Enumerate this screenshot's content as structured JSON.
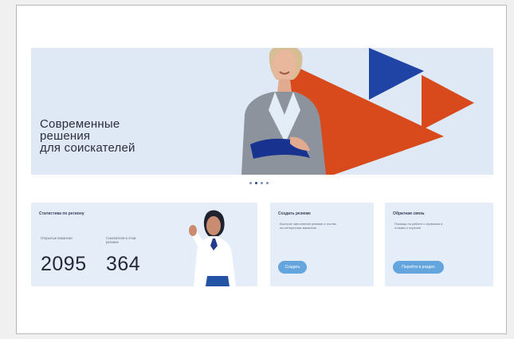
{
  "hero": {
    "title_lines": [
      "Современные",
      "решения",
      "для соискателей"
    ],
    "carousel": {
      "active_index": 1,
      "count": 4
    },
    "colors": {
      "background": "#dfe8f5",
      "accent_orange": "#d8491b",
      "accent_blue": "#1f44a6"
    }
  },
  "vacancies": {
    "title": "Статистика по региону",
    "stats": [
      {
        "label": "Открытые вакансии",
        "value": "2095"
      },
      {
        "label": "Соискатели в этом регионе",
        "value": "364"
      }
    ]
  },
  "account": {
    "title": "Создать резюме",
    "text": "Быстрое заполнение резюме и отклик на интересные вакансии",
    "button_label": "Создать"
  },
  "feedback": {
    "title": "Обратная связь",
    "text": "Помощь по работе с сервисом и отзывы о портале",
    "button_label": "Перейти в раздел"
  }
}
